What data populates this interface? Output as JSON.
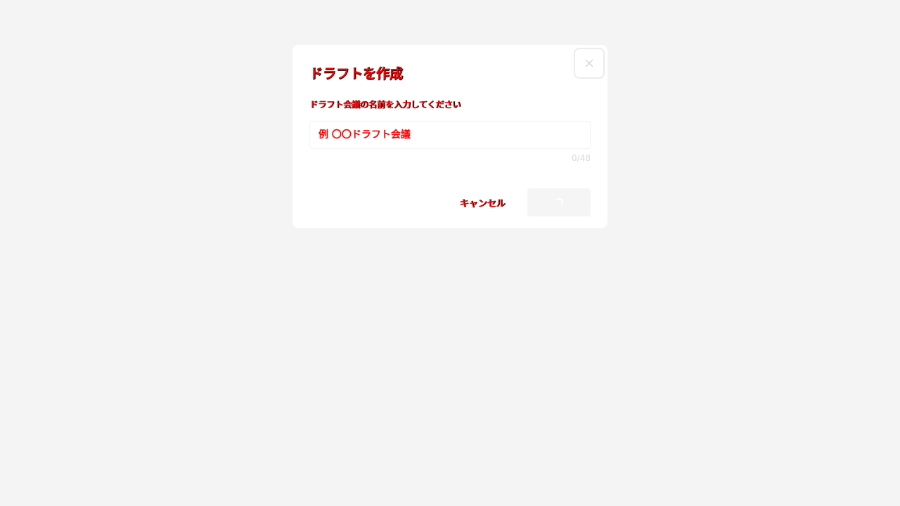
{
  "dialog": {
    "title": "ドラフトを作成",
    "field_label": "ドラフト会議の名前を入力してください",
    "input": {
      "value": "",
      "placeholder": "例 〇〇ドラフト会議"
    },
    "char_count": "0/48",
    "buttons": {
      "cancel_label": "キャンセル",
      "create_state": "loading"
    },
    "close_icon": "close-icon",
    "colors": {
      "background": "#f4f4f4",
      "dialog": "#ffffff",
      "text": "#ff0000",
      "counter": "#d9d9d9",
      "create_button_bg": "#f5f5f5"
    }
  }
}
